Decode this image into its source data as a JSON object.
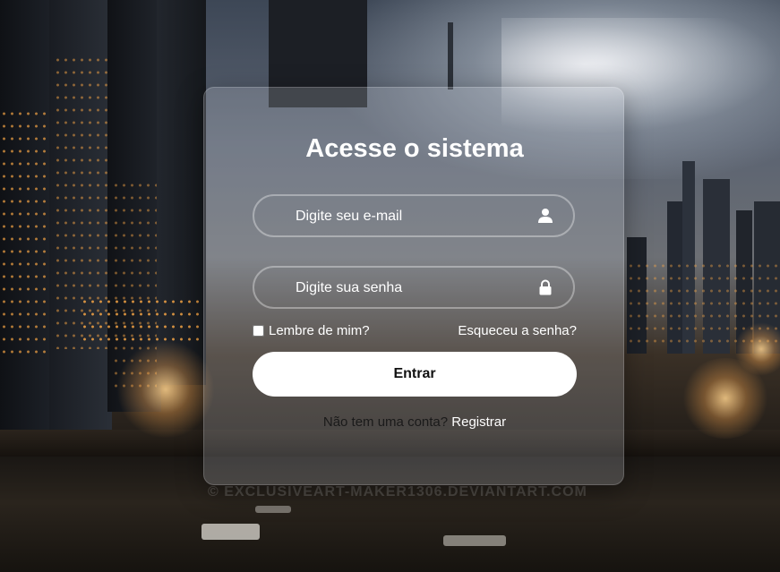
{
  "login": {
    "title": "Acesse o sistema",
    "email_placeholder": "Digite seu e-mail",
    "password_placeholder": "Digite sua senha",
    "remember_label": "Lembre de mim?",
    "remember_checked": false,
    "forgot_label": "Esqueceu a senha?",
    "submit_label": "Entrar",
    "register_prompt": "Não tem uma conta?",
    "register_link": "Registrar"
  },
  "background": {
    "watermark": "© EXCLUSIVEART-MAKER1306.DEVIANTART.COM"
  },
  "icons": {
    "email": "user-icon",
    "password": "lock-icon"
  },
  "colors": {
    "card_bg": "rgba(205,210,218,0.22)",
    "button_bg": "#ffffff",
    "text": "#ffffff"
  }
}
